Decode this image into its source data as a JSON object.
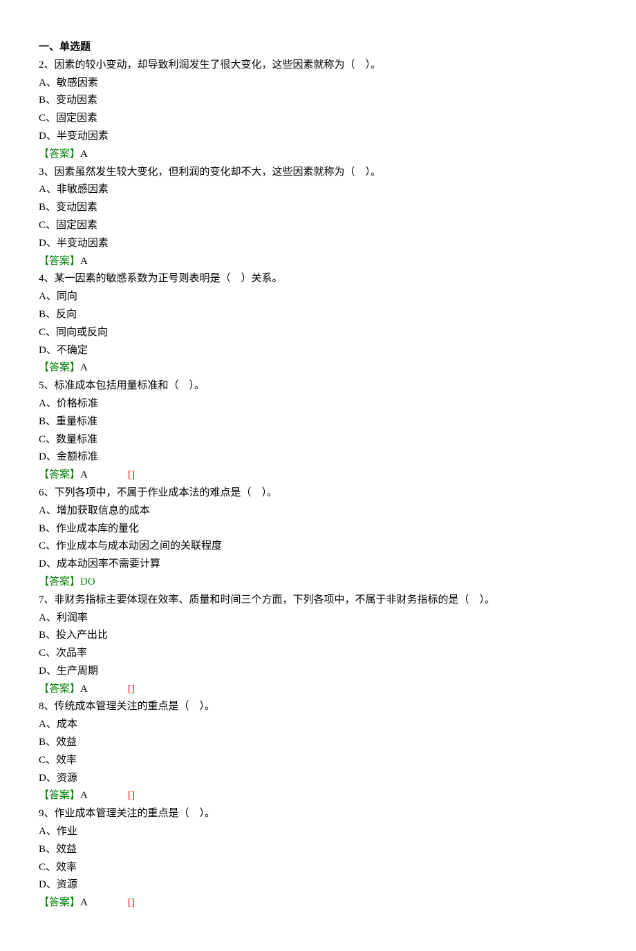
{
  "heading": "一、单选题",
  "questions": [
    {
      "number": "2",
      "text": "、因素的较小变动，却导致利润发生了很大变化，这些因素就称为（　）。",
      "options": [
        "A、敏感因素",
        "B、变动因素",
        "C、固定因素",
        "D、半变动因素"
      ],
      "answer_label": "【答案】",
      "answer": "A",
      "bracket": ""
    },
    {
      "number": "3",
      "text": "、因素虽然发生较大变化，但利润的变化却不大，这些因素就称为（　）。",
      "options": [
        "A、非敏感因素",
        "B、变动因素",
        "C、固定因素",
        "D、半变动因素"
      ],
      "answer_label": "【答案】",
      "answer": "A",
      "bracket": ""
    },
    {
      "number": "4",
      "text": "、某一因素的敏感系数为正号则表明是（　）关系。",
      "options": [
        "A、同向",
        "B、反向",
        "C、同向或反向",
        "D、不确定"
      ],
      "answer_label": "【答案】",
      "answer": "A",
      "bracket": ""
    },
    {
      "number": "5",
      "text": "、标准成本包括用量标准和（　）。",
      "options": [
        "A、价格标准",
        "B、重量标准",
        "C、数量标准",
        "D、金额标准"
      ],
      "answer_label": "【答案】",
      "answer": "A",
      "bracket": "[]"
    },
    {
      "number": "6",
      "text": "、下列各项中，不属于作业成本法的难点是（　）。",
      "options": [
        "A、增加获取信息的成本",
        "B、作业成本库的量化",
        "C、作业成本与成本动因之间的关联程度",
        "D、成本动因率不需要计算"
      ],
      "answer_label": "【答案】",
      "answer": "DO",
      "bracket": ""
    },
    {
      "number": "7",
      "text": "、非财务指标主要体现在效率、质量和时间三个方面，下列各项中，不属于非财务指标的是（　）。",
      "options": [
        "A、利润率",
        "B、投入产出比",
        "C、次品率",
        "D、生产周期"
      ],
      "answer_label": "【答案】",
      "answer": "A",
      "bracket": "[]"
    },
    {
      "number": "8",
      "text": "、传统成本管理关注的重点是（　）。",
      "options": [
        "A、成本",
        "B、效益",
        "C、效率",
        "D、资源"
      ],
      "answer_label": "【答案】",
      "answer": "A",
      "bracket": "[]"
    },
    {
      "number": "9",
      "text": "、作业成本管理关注的重点是（　）。",
      "options": [
        "A、作业",
        "B、效益",
        "C、效率",
        "D、资源"
      ],
      "answer_label": "【答案】",
      "answer": "A",
      "bracket": "[]"
    }
  ]
}
